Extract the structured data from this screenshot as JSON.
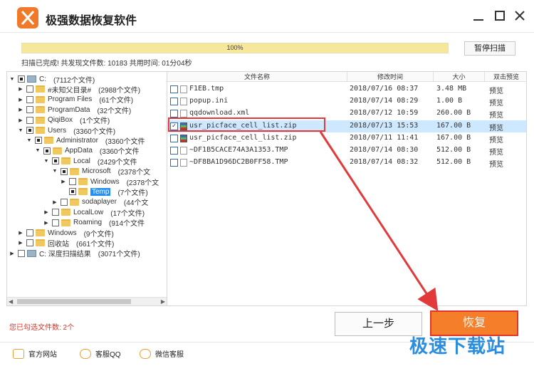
{
  "app": {
    "title": "极强数据恢复软件"
  },
  "progress": {
    "percent_text": "100%",
    "fraction": 1.0
  },
  "pause_button": "暂停扫描",
  "scan_status": "扫描已完成! 共发现文件数: 10183  共用时间: 01分04秒",
  "tree": [
    {
      "label": "C:",
      "count": "(7112个文件)",
      "icon": "drive-icon",
      "expander": "▼"
    },
    {
      "label": "#未知父目录#",
      "count": "(2988个文件)",
      "icon": "folder-icon",
      "expander": "▶"
    },
    {
      "label": "Program Files",
      "count": "(61个文件)",
      "icon": "folder-icon",
      "expander": "▶"
    },
    {
      "label": "ProgramData",
      "count": "(32个文件)",
      "icon": "folder-icon",
      "expander": "▶"
    },
    {
      "label": "QiqiBox",
      "count": "(1个文件)",
      "icon": "folder-icon",
      "expander": "▶"
    },
    {
      "label": "Users",
      "count": "(3360个文件)",
      "icon": "folder-icon",
      "expander": "▼"
    },
    {
      "label": "Administrator",
      "count": "(3360个文件",
      "icon": "folder-icon",
      "expander": "▼"
    },
    {
      "label": "AppData",
      "count": "(3360个文件",
      "icon": "folder-icon",
      "expander": "▼"
    },
    {
      "label": "Local",
      "count": "(2429个文件",
      "icon": "folder-icon",
      "expander": "▼"
    },
    {
      "label": "Microsoft",
      "count": "(2378个文",
      "icon": "folder-icon",
      "expander": "▼"
    },
    {
      "label": "Windows",
      "count": "(2378个文",
      "icon": "folder-icon",
      "expander": "▶"
    },
    {
      "label": "Temp",
      "count": "(7个文件)",
      "icon": "folder-icon",
      "expander": ""
    },
    {
      "label": "sodaplayer",
      "count": "(44个文",
      "icon": "folder-icon",
      "expander": "▶"
    },
    {
      "label": "LocalLow",
      "count": "(17个文件)",
      "icon": "folder-icon",
      "expander": "▶"
    },
    {
      "label": "Roaming",
      "count": "(914个文件",
      "icon": "folder-icon",
      "expander": "▶"
    },
    {
      "label": "Windows",
      "count": "(9个文件)",
      "icon": "folder-icon",
      "expander": "▶"
    },
    {
      "label": "回收站",
      "count": "(661个文件)",
      "icon": "folder-icon",
      "expander": "▶"
    },
    {
      "label": "C: 深度扫描结果",
      "count": "(3071个文件)",
      "icon": "drive-icon",
      "expander": "▶"
    }
  ],
  "list": {
    "headers": [
      "文件名称",
      "修改时间",
      "大小",
      "双击预览"
    ],
    "rows": [
      {
        "name": "F1EB.tmp",
        "date": "2018/07/16 08:37",
        "size": "3.48 MB",
        "preview": "预览",
        "icon": "file-icon",
        "checked": false
      },
      {
        "name": "popup.ini",
        "date": "2018/07/14 08:29",
        "size": "1.00 B",
        "preview": "预览",
        "icon": "file-icon",
        "checked": false
      },
      {
        "name": "qqdownload.xml",
        "date": "2018/07/12 10:59",
        "size": "260.00 B",
        "preview": "预览",
        "icon": "file-icon",
        "checked": false
      },
      {
        "name": "usr_picface_cell_list.zip",
        "date": "2018/07/13 15:53",
        "size": "167.00 B",
        "preview": "预览",
        "icon": "zip-icon",
        "checked": true
      },
      {
        "name": "usr_picface_cell_list.zip",
        "date": "2018/07/11 11:41",
        "size": "167.00 B",
        "preview": "预览",
        "icon": "zip-icon",
        "checked": false
      },
      {
        "name": "~DF1B5CACE74A3A1353.TMP",
        "date": "2018/07/14 08:30",
        "size": "512.00 B",
        "preview": "预览",
        "icon": "file-icon",
        "checked": false
      },
      {
        "name": "~DF8BA1D96DC2B0FF58.TMP",
        "date": "2018/07/14 08:32",
        "size": "512.00 B",
        "preview": "预览",
        "icon": "file-icon",
        "checked": false
      }
    ]
  },
  "selected_count": "您已勾选文件数: 2个",
  "back_button": "上一步",
  "recover_button": "恢复",
  "footer": {
    "links": [
      "官方网站",
      "客服QQ",
      "微信客服"
    ],
    "icons": [
      "website-icon",
      "qq-icon",
      "wechat-icon"
    ]
  },
  "watermark": "极速下载站",
  "colors": {
    "accent": "#f47e2a",
    "selection": "#cde8ff",
    "annotation": "#e23a3a"
  }
}
